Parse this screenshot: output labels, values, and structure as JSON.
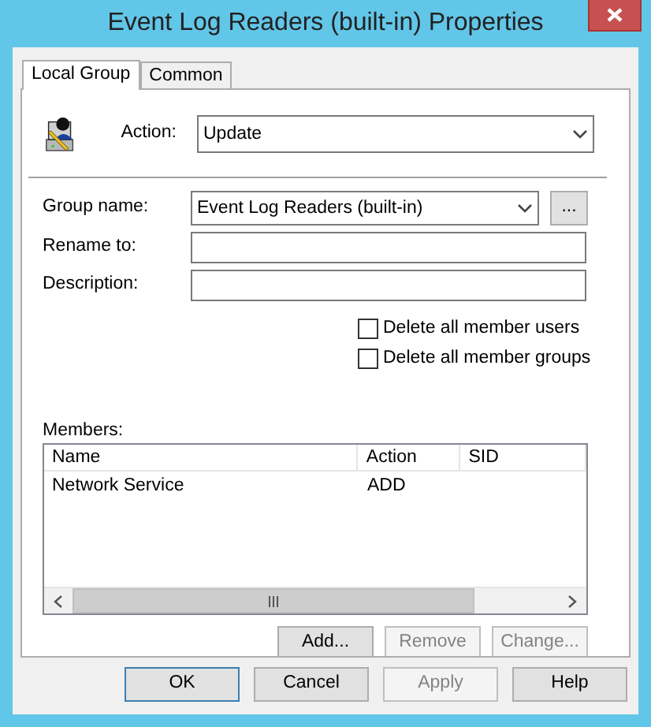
{
  "window": {
    "title": "Event Log Readers (built-in) Properties"
  },
  "tabs": [
    {
      "label": "Local Group",
      "selected": true
    },
    {
      "label": "Common",
      "selected": false
    }
  ],
  "action": {
    "label": "Action:",
    "value": "Update"
  },
  "fields": [
    {
      "kind": "combo",
      "label": "Group name:",
      "value": "Event Log Readers (built-in)",
      "browse": "..."
    },
    {
      "kind": "text",
      "label": "Rename to:"
    },
    {
      "kind": "text",
      "label": "Description:"
    }
  ],
  "checkboxes": [
    {
      "label": "Delete all member users",
      "checked": false
    },
    {
      "label": "Delete all member groups",
      "checked": false
    }
  ],
  "members": {
    "label": "Members:",
    "columns": [
      "Name",
      "Action",
      "SID"
    ],
    "rows": [
      {
        "name": "Network Service",
        "action": "ADD"
      }
    ]
  },
  "member_buttons": [
    {
      "label": "Add...",
      "disabled": false
    },
    {
      "label": "Remove",
      "disabled": true
    },
    {
      "label": "Change...",
      "disabled": true
    }
  ],
  "dialog_buttons": [
    {
      "label": "OK",
      "disabled": false,
      "default": true
    },
    {
      "label": "Cancel",
      "disabled": false,
      "default": false
    },
    {
      "label": "Apply",
      "disabled": true,
      "default": false
    },
    {
      "label": "Help",
      "disabled": false,
      "default": false
    }
  ]
}
